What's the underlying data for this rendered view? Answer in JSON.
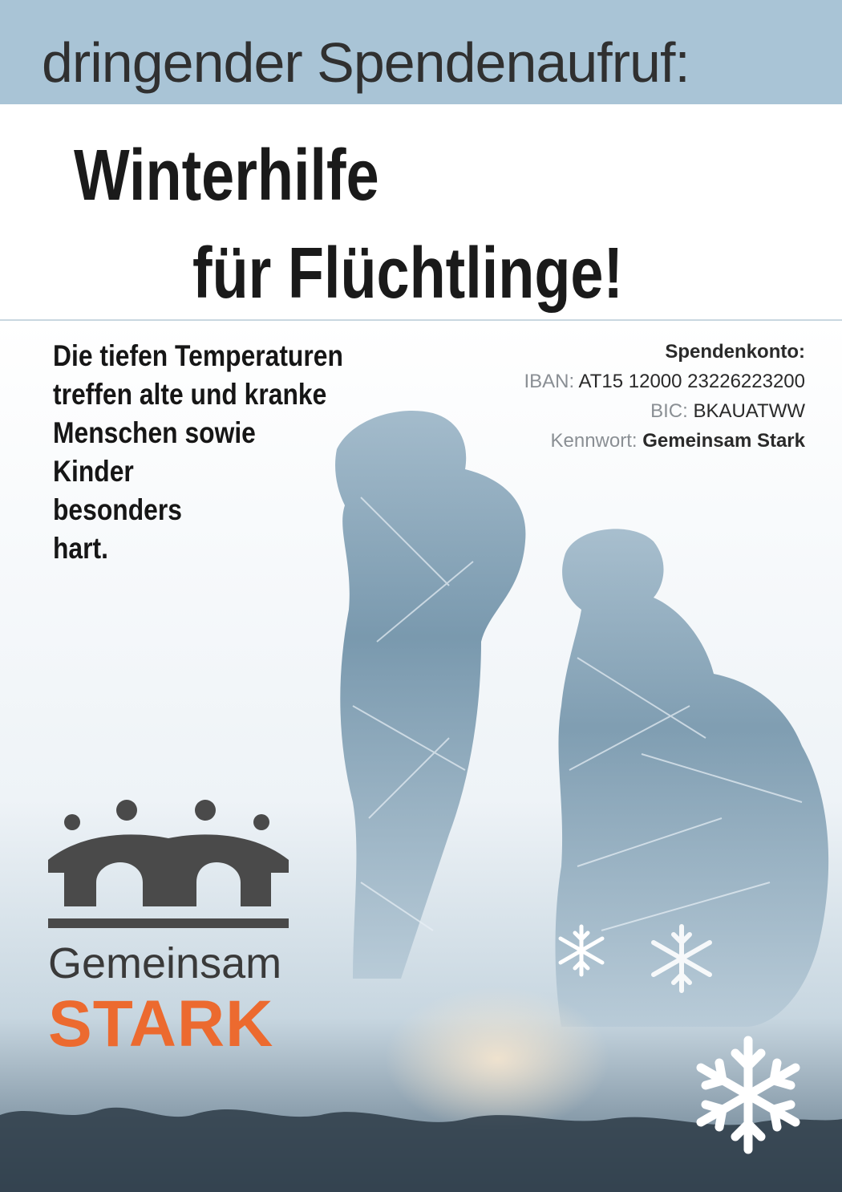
{
  "banner": {
    "text": "dringender Spendenaufruf:",
    "color": "#a9c4d6"
  },
  "headline": {
    "line1": "Winterhilfe",
    "line2": "für Flüchtlinge!"
  },
  "body_text": [
    "Die tiefen Temperaturen",
    "treffen alte und kranke",
    "Menschen sowie",
    "Kinder",
    "besonders",
    "hart."
  ],
  "account": {
    "title": "Spendenkonto:",
    "iban_label": "IBAN:",
    "iban_value": "AT15 12000 23226223200",
    "bic_label": "BIC:",
    "bic_value": "BKAUATWW",
    "keyword_label": "Kennwort:",
    "keyword_value": "Gemeinsam Stark"
  },
  "logo": {
    "line1": "Gemeinsam",
    "line2": "STARK",
    "accent_color": "#ec6a2f",
    "icon": "people-bridge-icon"
  },
  "decorations": {
    "icon": "snowflake-icon"
  }
}
